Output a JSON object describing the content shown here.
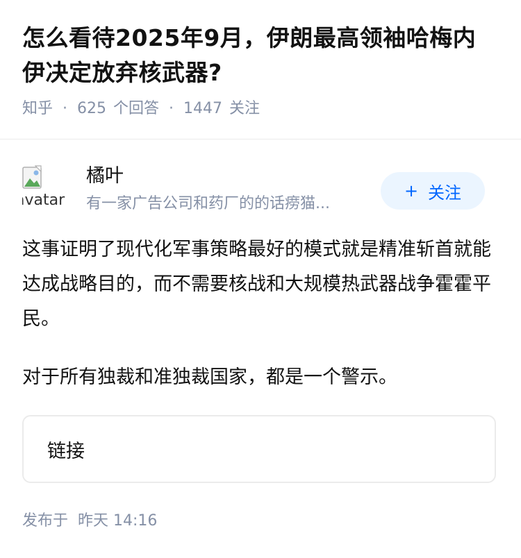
{
  "question": {
    "title": "怎么看待2025年9月，伊朗最高领袖哈梅内伊决定放弃核武器?",
    "source": "知乎",
    "answer_count": "625",
    "answer_label": "个回答",
    "follower_count": "1447",
    "follower_label": "关注"
  },
  "author": {
    "name": "橘叶",
    "bio": "有一家广告公司和药厂的的话痨猫...",
    "avatar_alt": "avatar",
    "follow_label": "关注",
    "follow_icon": "plus-icon"
  },
  "answer": {
    "paragraphs": [
      "这事证明了现代化军事策略最好的模式就是精准斩首就能达成战略目的，而不需要核战和大规模热武器战争霍霍平民。",
      "对于所有独裁和准独裁国家，都是一个警示。"
    ],
    "link_label": "链接"
  },
  "footer": {
    "published_label": "发布于",
    "published_time": "昨天 14:16"
  },
  "colors": {
    "text": "#121212",
    "meta": "#8590a6",
    "accent": "#0066ff",
    "follow_bg": "#ebf5ff",
    "divider": "#ebebeb"
  }
}
